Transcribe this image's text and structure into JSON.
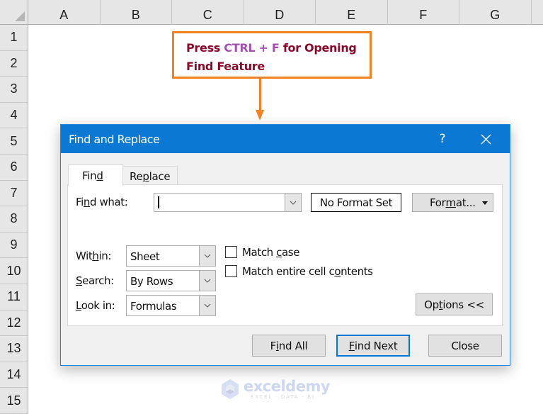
{
  "sheet": {
    "columns": [
      "A",
      "B",
      "C",
      "D",
      "E",
      "F",
      "G"
    ],
    "rows": [
      "1",
      "2",
      "3",
      "4",
      "5",
      "6",
      "7",
      "8",
      "9",
      "10",
      "11",
      "12",
      "13",
      "14",
      "15"
    ]
  },
  "callout": {
    "line1_part1": "Press ",
    "line1_highlight": "CTRL + F",
    "line1_part2": " for Opening",
    "line2": "Find Feature",
    "border_color": "#f58220",
    "text_color": "#8b0a2b",
    "highlight_color": "#a34fb0"
  },
  "dialog": {
    "title": "Find and Replace",
    "help_label": "?",
    "accent_color": "#0b78d4",
    "tabs": [
      {
        "label_pre": "Fin",
        "label_u": "d",
        "label_post": "",
        "active": true
      },
      {
        "label_pre": "Re",
        "label_u": "p",
        "label_post": "lace",
        "active": false
      }
    ],
    "find_what": {
      "label_pre": "Fi",
      "label_u": "n",
      "label_post": "d what:",
      "value": ""
    },
    "no_format_label": "No Format Set",
    "format_button": {
      "label_pre": "For",
      "label_u": "m",
      "label_post": "at..."
    },
    "within": {
      "label_pre": "Wit",
      "label_u": "h",
      "label_post": "in:",
      "value": "Sheet"
    },
    "search": {
      "label_pre": "",
      "label_u": "S",
      "label_post": "earch:",
      "value": "By Rows"
    },
    "look_in": {
      "label_pre": "",
      "label_u": "L",
      "label_post": "ook in:",
      "value": "Formulas"
    },
    "match_case": {
      "label_pre": "Match ",
      "label_u": "c",
      "label_post": "ase",
      "checked": false
    },
    "match_entire": {
      "label_pre": "Match entire cell c",
      "label_u": "o",
      "label_post": "ntents",
      "checked": false
    },
    "options_button": {
      "label_pre": "Op",
      "label_u": "t",
      "label_post": "ions <<"
    },
    "find_all_button": {
      "label_pre": "F",
      "label_u": "i",
      "label_post": "nd All"
    },
    "find_next_button": {
      "label_pre": "",
      "label_u": "F",
      "label_post": "ind Next"
    },
    "close_button": {
      "label": "Close"
    }
  },
  "watermark": {
    "brand": "exceldemy",
    "tagline": "EXCEL · DATA · BI"
  }
}
